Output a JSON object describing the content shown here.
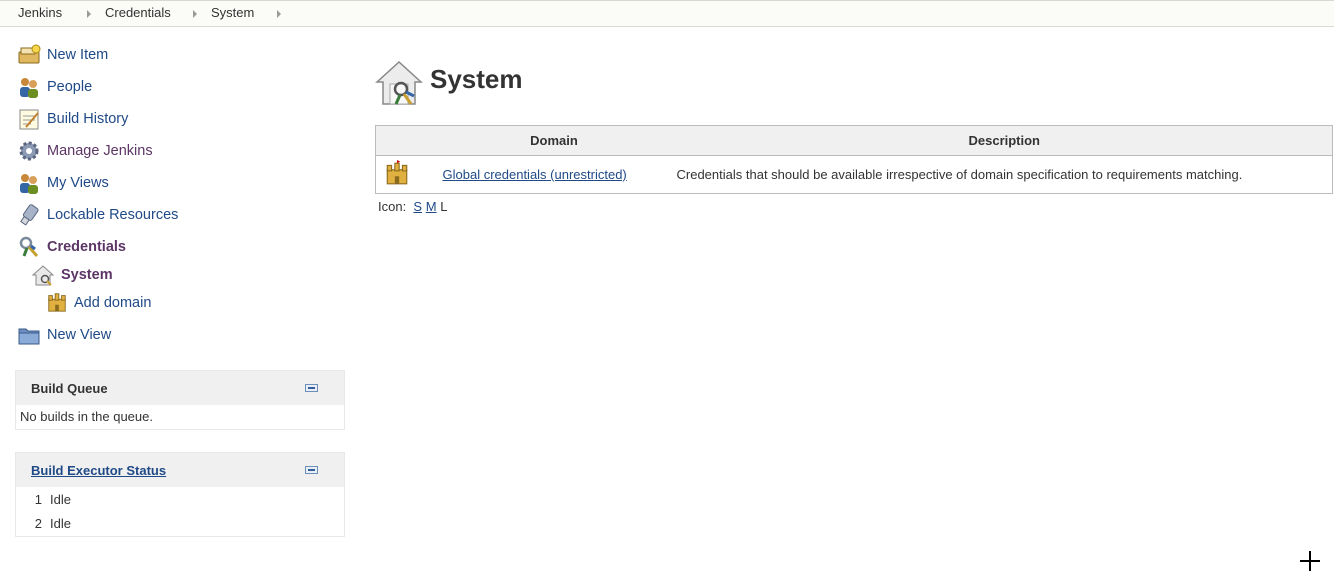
{
  "breadcrumbs": [
    "Jenkins",
    "Credentials",
    "System"
  ],
  "sidebar": {
    "items": [
      {
        "label": "New Item",
        "icon": "new-item-icon"
      },
      {
        "label": "People",
        "icon": "people-icon"
      },
      {
        "label": "Build History",
        "icon": "notepad-icon"
      },
      {
        "label": "Manage Jenkins",
        "icon": "gear-icon"
      },
      {
        "label": "My Views",
        "icon": "people-icon"
      },
      {
        "label": "Lockable Resources",
        "icon": "usb-drive-icon"
      },
      {
        "label": "Credentials",
        "icon": "keys-icon"
      },
      {
        "label": "System",
        "icon": "house-icon"
      },
      {
        "label": "Add domain",
        "icon": "castle-icon"
      },
      {
        "label": "New View",
        "icon": "folder-icon"
      }
    ]
  },
  "build_queue": {
    "title": "Build Queue",
    "empty_text": "No builds in the queue."
  },
  "executor_status": {
    "title": "Build Executor Status",
    "executors": [
      {
        "num": "1",
        "status": "Idle"
      },
      {
        "num": "2",
        "status": "Idle"
      }
    ]
  },
  "main": {
    "title": "System",
    "table": {
      "headers": [
        "Domain",
        "Description"
      ],
      "rows": [
        {
          "domain": "Global credentials (unrestricted)",
          "description": "Credentials that should be available irrespective of domain specification to requirements matching."
        }
      ]
    },
    "icon_size": {
      "label": "Icon:",
      "options": [
        "S",
        "M",
        "L"
      ]
    }
  },
  "colors": {
    "link": "#204a87",
    "visited": "#5c3566",
    "header_bg": "#f0f0f0"
  }
}
